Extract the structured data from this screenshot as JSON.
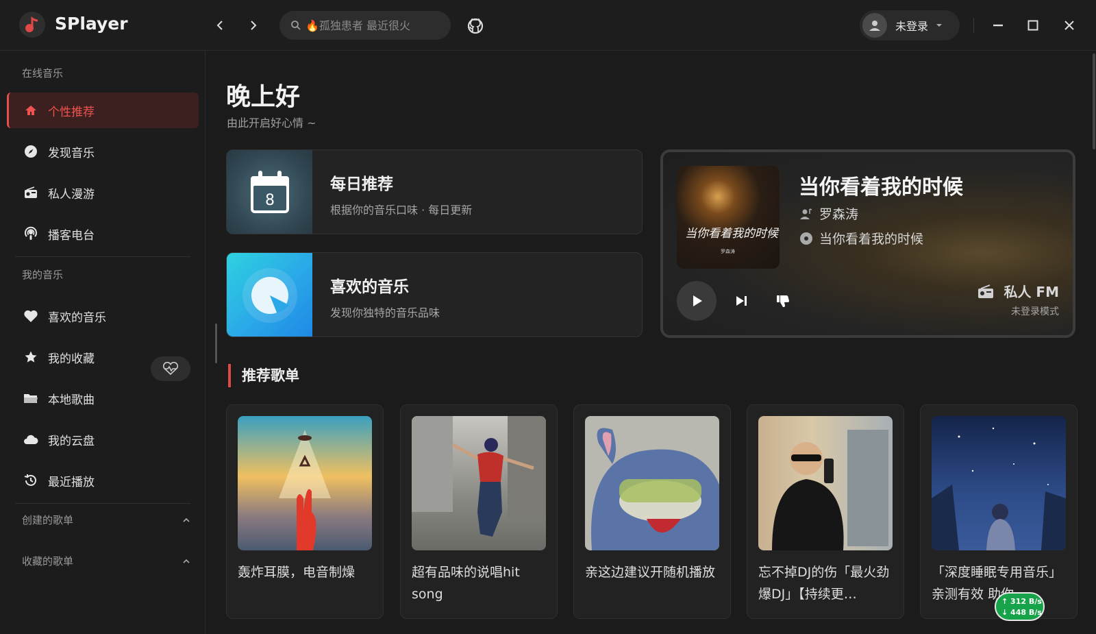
{
  "app": {
    "name": "SPlayer"
  },
  "header": {
    "search_placeholder": "🔥孤独患者 最近很火",
    "user_name": "未登录"
  },
  "sidebar": {
    "online_title": "在线音乐",
    "online_items": [
      {
        "label": "个性推荐",
        "icon": "home-icon",
        "active": true
      },
      {
        "label": "发现音乐",
        "icon": "compass-icon"
      },
      {
        "label": "私人漫游",
        "icon": "radio-icon"
      },
      {
        "label": "播客电台",
        "icon": "podcast-icon"
      }
    ],
    "mine_title": "我的音乐",
    "mine_items": [
      {
        "label": "喜欢的音乐",
        "icon": "heart-icon"
      },
      {
        "label": "我的收藏",
        "icon": "star-icon"
      },
      {
        "label": "本地歌曲",
        "icon": "folder-icon"
      },
      {
        "label": "我的云盘",
        "icon": "cloud-icon"
      },
      {
        "label": "最近播放",
        "icon": "history-icon"
      }
    ],
    "created_playlists": "创建的歌单",
    "collected_playlists": "收藏的歌单"
  },
  "main": {
    "greeting": "晚上好",
    "greeting_sub": "由此开启好心情 ~",
    "daily": {
      "title": "每日推荐",
      "subtitle": "根据你的音乐口味 · 每日更新",
      "day": "8"
    },
    "liked": {
      "title": "喜欢的音乐",
      "subtitle": "发现你独特的音乐品味"
    },
    "fm": {
      "song": "当你看着我的时候",
      "artist": "罗森涛",
      "album": "当你看着我的时候",
      "cover_text": "当你看着我的时候",
      "cover_small": "罗森涛",
      "label": "私人 FM",
      "mode": "未登录模式"
    },
    "section_title": "推荐歌单",
    "playlists": [
      {
        "name": "轰炸耳膜，电音制燥"
      },
      {
        "name": "超有品味的说唱hit song"
      },
      {
        "name": "亲这边建议开随机播放"
      },
      {
        "name": "忘不掉DJ的伤「最火劲爆DJ」【持续更…"
      },
      {
        "name": "「深度睡眠专用音乐」亲测有效 助你…"
      }
    ]
  },
  "network": {
    "up": "↑ 312 B/s",
    "down": "↓ 448 B/s"
  },
  "colors": {
    "accent": "#e35050",
    "background": "#1b1b1b",
    "network_badge": "#16a34a"
  }
}
